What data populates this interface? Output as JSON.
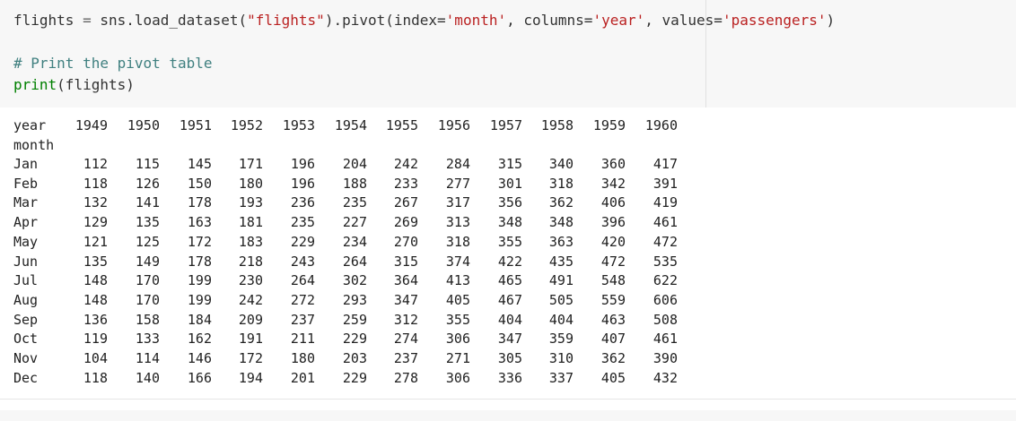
{
  "code": {
    "line1": {
      "a": "flights",
      "b": " = ",
      "c": "sns.load_dataset(",
      "d": "\"flights\"",
      "e": ").pivot(index=",
      "f": "'month'",
      "g": ", columns=",
      "h": "'year'",
      "i": ", values=",
      "j": "'passengers'",
      "k": ")"
    },
    "line2": "# Print the pivot table",
    "line3": {
      "fn": "print",
      "arg": "(flights)"
    }
  },
  "output": {
    "header_label": "year",
    "index_label": "month",
    "years": [
      "1949",
      "1950",
      "1951",
      "1952",
      "1953",
      "1954",
      "1955",
      "1956",
      "1957",
      "1958",
      "1959",
      "1960"
    ],
    "rows": [
      {
        "month": "Jan",
        "values": [
          "112",
          "115",
          "145",
          "171",
          "196",
          "204",
          "242",
          "284",
          "315",
          "340",
          "360",
          "417"
        ]
      },
      {
        "month": "Feb",
        "values": [
          "118",
          "126",
          "150",
          "180",
          "196",
          "188",
          "233",
          "277",
          "301",
          "318",
          "342",
          "391"
        ]
      },
      {
        "month": "Mar",
        "values": [
          "132",
          "141",
          "178",
          "193",
          "236",
          "235",
          "267",
          "317",
          "356",
          "362",
          "406",
          "419"
        ]
      },
      {
        "month": "Apr",
        "values": [
          "129",
          "135",
          "163",
          "181",
          "235",
          "227",
          "269",
          "313",
          "348",
          "348",
          "396",
          "461"
        ]
      },
      {
        "month": "May",
        "values": [
          "121",
          "125",
          "172",
          "183",
          "229",
          "234",
          "270",
          "318",
          "355",
          "363",
          "420",
          "472"
        ]
      },
      {
        "month": "Jun",
        "values": [
          "135",
          "149",
          "178",
          "218",
          "243",
          "264",
          "315",
          "374",
          "422",
          "435",
          "472",
          "535"
        ]
      },
      {
        "month": "Jul",
        "values": [
          "148",
          "170",
          "199",
          "230",
          "264",
          "302",
          "364",
          "413",
          "465",
          "491",
          "548",
          "622"
        ]
      },
      {
        "month": "Aug",
        "values": [
          "148",
          "170",
          "199",
          "242",
          "272",
          "293",
          "347",
          "405",
          "467",
          "505",
          "559",
          "606"
        ]
      },
      {
        "month": "Sep",
        "values": [
          "136",
          "158",
          "184",
          "209",
          "237",
          "259",
          "312",
          "355",
          "404",
          "404",
          "463",
          "508"
        ]
      },
      {
        "month": "Oct",
        "values": [
          "119",
          "133",
          "162",
          "191",
          "211",
          "229",
          "274",
          "306",
          "347",
          "359",
          "407",
          "461"
        ]
      },
      {
        "month": "Nov",
        "values": [
          "104",
          "114",
          "146",
          "172",
          "180",
          "203",
          "237",
          "271",
          "305",
          "310",
          "362",
          "390"
        ]
      },
      {
        "month": "Dec",
        "values": [
          "118",
          "140",
          "166",
          "194",
          "201",
          "229",
          "278",
          "306",
          "336",
          "337",
          "405",
          "432"
        ]
      }
    ]
  }
}
